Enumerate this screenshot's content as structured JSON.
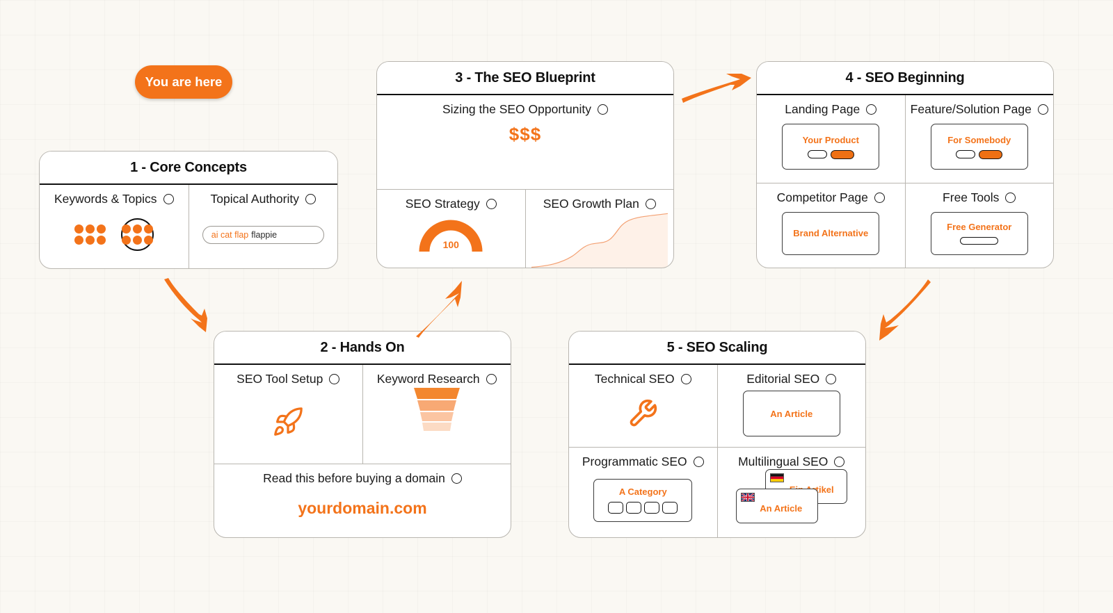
{
  "badge": {
    "label": "You are here"
  },
  "accent": "#f3731a",
  "cards": [
    {
      "id": "core-concepts",
      "title": "1 - Core Concepts",
      "cells": [
        {
          "id": "keywords-topics",
          "label": "Keywords & Topics",
          "art": "dot-clusters"
        },
        {
          "id": "topical-authority",
          "label": "Topical Authority",
          "art": "search-pill",
          "query": "ai cat flap",
          "suffix": "flappie"
        }
      ]
    },
    {
      "id": "hands-on",
      "title": "2 - Hands On",
      "cells": [
        {
          "id": "seo-tool-setup",
          "label": "SEO Tool Setup",
          "art": "rocket-icon"
        },
        {
          "id": "keyword-research",
          "label": "Keyword Research",
          "art": "funnel"
        },
        {
          "id": "buying-a-domain",
          "label": "Read this before buying a domain",
          "art": "domain-text",
          "domain": "yourdomain.com"
        }
      ]
    },
    {
      "id": "seo-blueprint",
      "title": "3 - The SEO Blueprint",
      "cells": [
        {
          "id": "sizing-opportunity",
          "label": "Sizing the SEO Opportunity",
          "art": "dollars",
          "value": "$$$"
        },
        {
          "id": "seo-strategy",
          "label": "SEO Strategy",
          "art": "gauge",
          "value": "100"
        },
        {
          "id": "seo-growth-plan",
          "label": "SEO Growth Plan",
          "art": "growth-chart"
        }
      ]
    },
    {
      "id": "seo-beginning",
      "title": "4 - SEO Beginning",
      "cells": [
        {
          "id": "landing-page",
          "label": "Landing Page",
          "art": "page-toggle",
          "mock": "Your Product"
        },
        {
          "id": "feature-solution-page",
          "label": "Feature/Solution Page",
          "art": "page-toggle",
          "mock": "For Somebody"
        },
        {
          "id": "competitor-page",
          "label": "Competitor Page",
          "art": "page-plain",
          "mock": "Brand Alternative"
        },
        {
          "id": "free-tools",
          "label": "Free Tools",
          "art": "page-bar",
          "mock": "Free Generator"
        }
      ]
    },
    {
      "id": "seo-scaling",
      "title": "5 - SEO Scaling",
      "cells": [
        {
          "id": "technical-seo",
          "label": "Technical SEO",
          "art": "wrench-icon"
        },
        {
          "id": "editorial-seo",
          "label": "Editorial SEO",
          "art": "page-plain",
          "mock": "An Article"
        },
        {
          "id": "programmatic-seo",
          "label": "Programmatic SEO",
          "art": "page-chips",
          "mock": "A Category"
        },
        {
          "id": "multilingual-seo",
          "label": "Multilingual SEO",
          "art": "page-stack",
          "mock_de": "Ein Artikel",
          "mock_en": "An Article"
        }
      ]
    }
  ],
  "arrows": [
    {
      "id": "arrow-1-to-2",
      "direction": "down-right"
    },
    {
      "id": "arrow-2-to-3",
      "direction": "up-right"
    },
    {
      "id": "arrow-3-to-4",
      "direction": "right"
    },
    {
      "id": "arrow-4-to-5",
      "direction": "down-left"
    }
  ]
}
